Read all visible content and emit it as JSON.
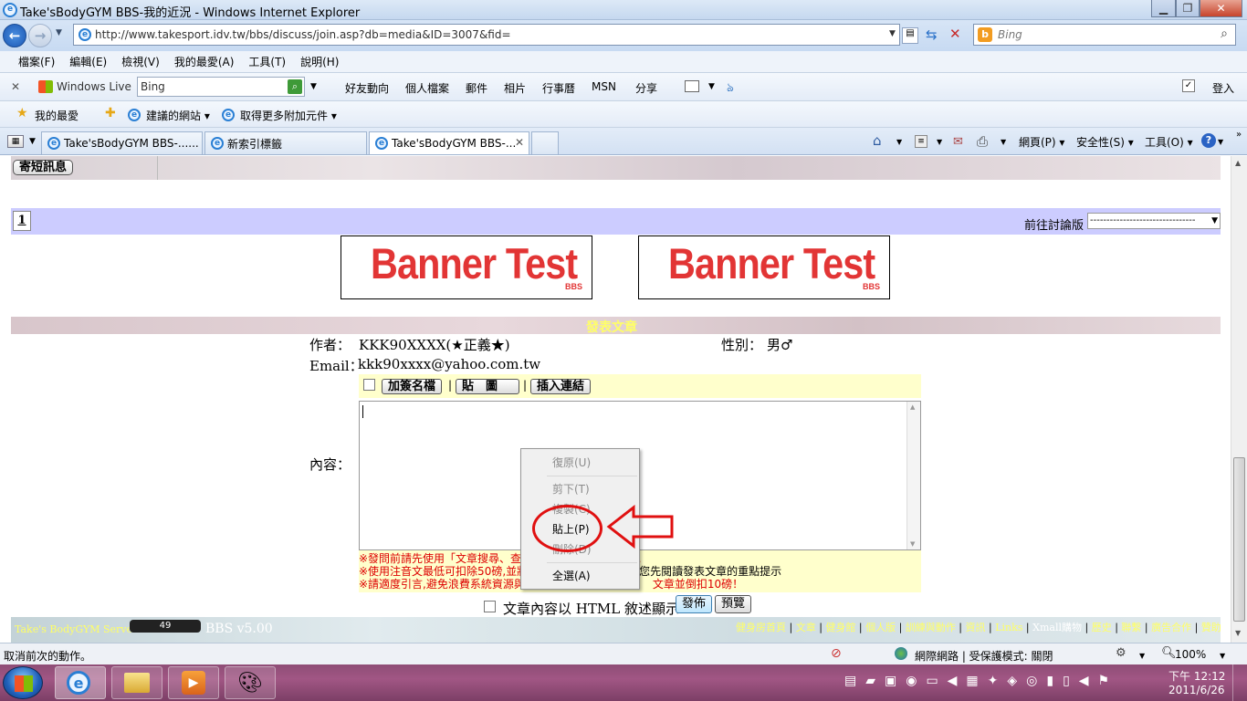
{
  "window": {
    "title": "Take'sBodyGYM BBS-我的近況 - Windows Internet Explorer"
  },
  "address": {
    "url": "http://www.takesport.idv.tw/bbs/discuss/join.asp?db=media&ID=3007&fid="
  },
  "search": {
    "placeholder": "Bing"
  },
  "menu": [
    "檔案(F)",
    "編輯(E)",
    "檢視(V)",
    "我的最愛(A)",
    "工具(T)",
    "說明(H)"
  ],
  "live_toolbar": {
    "brand": "Windows Live",
    "search_value": "Bing",
    "links": [
      "好友動向",
      "個人檔案",
      "郵件",
      "相片",
      "行事曆",
      "MSN",
      "分享"
    ],
    "signin": "登入"
  },
  "favorites": {
    "label": "我的最愛",
    "suggested": "建議的網站 ▾",
    "addons": "取得更多附加元件 ▾"
  },
  "tabs": [
    "Take'sBodyGYM BBS-......",
    "新索引標籤",
    "Take'sBodyGYM BBS-..."
  ],
  "command_bar": {
    "page": "網頁(P) ▾",
    "safety": "安全性(S) ▾",
    "tools": "工具(O) ▾"
  },
  "page": {
    "short_msg_button": "寄短訊息",
    "page_number": "1",
    "goto_forum_label": "前往討論版",
    "goto_forum_value": "--------------------------------",
    "banner_text": "Banner Test",
    "banner_sub": "BBS",
    "section_title": "發表文章",
    "author_label": "作者：",
    "author_value": "KKK90XXXX(★正義★)",
    "gender_label": "性別：",
    "gender_value": "男♂",
    "email_label": "Email：",
    "email_value": "kkk90xxxx@yahoo.com.tw",
    "sig_button": "加簽名檔",
    "img_button": "貼　圖",
    "link_button": "插入連結",
    "content_label": "內容：",
    "notice_lines": [
      "※發問前請先使用「文章搜尋、查",
      "※使用注音文最低可扣除50磅,並將",
      "※請適度引言,避免浪費系統資源與"
    ],
    "notice_tail": [
      "。",
      "問前請您先閱讀發表文章的重點提示",
      "文章並倒扣10磅！"
    ],
    "html_checkbox_label": "文章內容以 HTML 敘述顯示",
    "publish_button": "發佈",
    "preview_button": "預覽",
    "footer_left": "Take's BodyGYM Server:",
    "footer_counter": "49",
    "footer_version": "BBS v5.00",
    "footer_links": [
      "健身房首頁",
      "文章",
      "健身館",
      "個人版",
      "訓練與動作",
      "資訊",
      "Links",
      "Xmall購物",
      "歷史",
      "聯繫",
      "廣告合作",
      "贊助"
    ]
  },
  "context_menu": {
    "items": [
      "復原(U)",
      "剪下(T)",
      "複製(C)",
      "貼上(P)",
      "刪除(D)",
      "全選(A)"
    ],
    "disabled": [
      true,
      true,
      true,
      false,
      true,
      false
    ]
  },
  "status": {
    "text": "取消前次的動作。",
    "zone": "網際網路 | 受保護模式: 關閉",
    "zoom": "100%"
  },
  "taskbar": {
    "time": "下午 12:12",
    "date": "2011/6/26"
  }
}
